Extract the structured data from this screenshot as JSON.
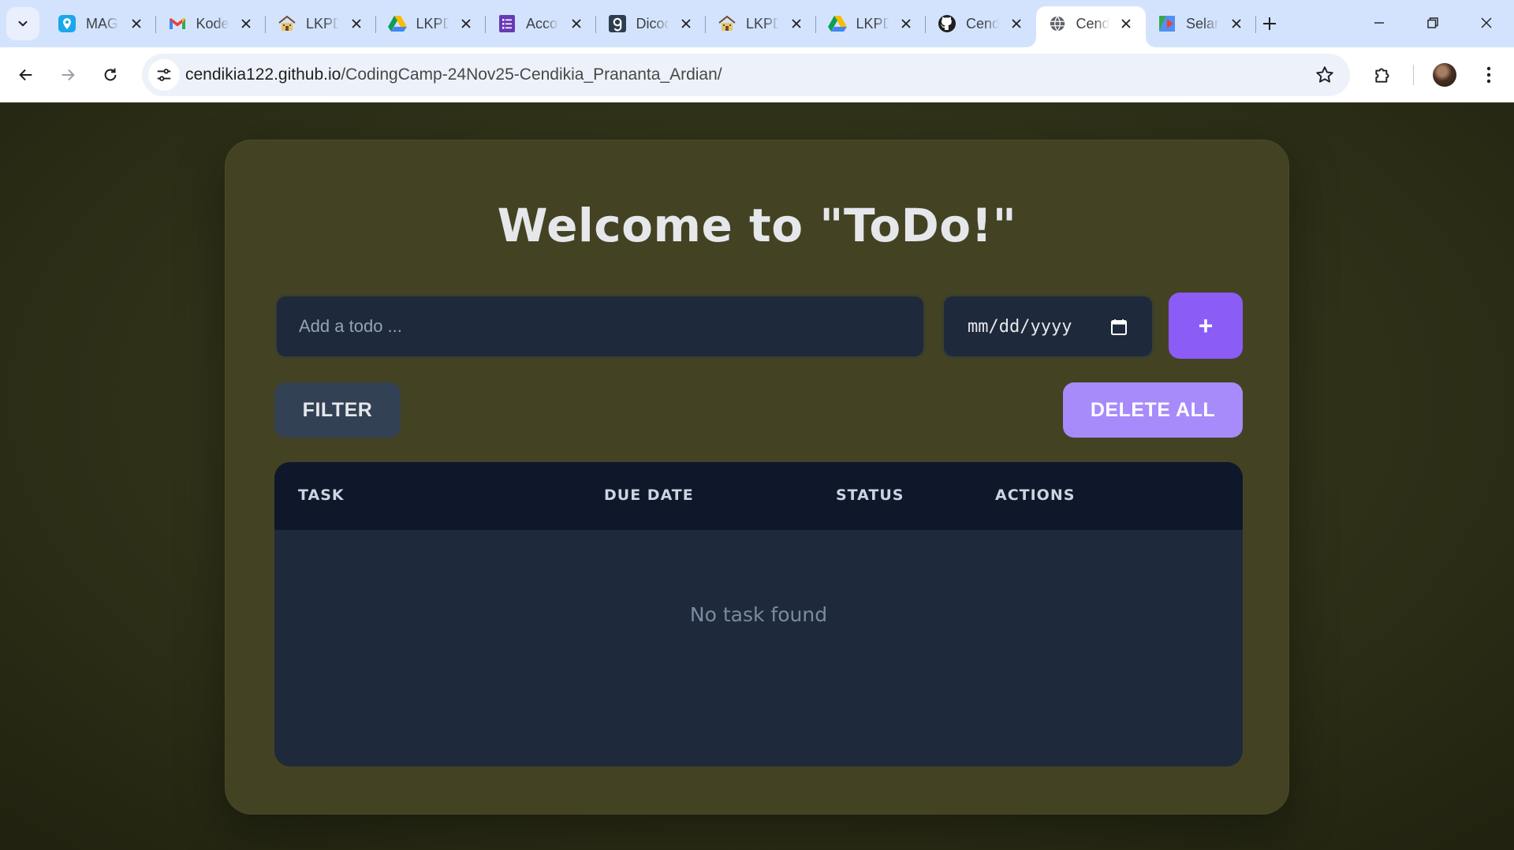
{
  "browser": {
    "tabs": [
      {
        "title": "MAGANG",
        "icon": "maps-pin-icon",
        "active": false
      },
      {
        "title": "Kode Verifikasi",
        "icon": "gmail-icon",
        "active": false
      },
      {
        "title": "LKPD",
        "icon": "school-icon",
        "active": false
      },
      {
        "title": "LKPD",
        "icon": "google-drive-icon",
        "active": false
      },
      {
        "title": "Accounting",
        "icon": "forms-icon",
        "active": false
      },
      {
        "title": "Dicoding",
        "icon": "dicoding-icon",
        "active": false
      },
      {
        "title": "LKPD",
        "icon": "school-icon",
        "active": false
      },
      {
        "title": "LKPD",
        "icon": "google-drive-icon",
        "active": false
      },
      {
        "title": "Cendikia",
        "icon": "github-icon",
        "active": false
      },
      {
        "title": "Cendikia",
        "icon": "globe-icon",
        "active": true
      },
      {
        "title": "Selamat",
        "icon": "kanban-icon",
        "active": false
      }
    ],
    "url_host": "cendikia122.github.io",
    "url_path": "/CodingCamp-24Nov25-Cendikia_Prananta_Ardian/"
  },
  "app": {
    "title": "Welcome to \"ToDo!\"",
    "todo_placeholder": "Add a todo ...",
    "date_placeholder": "mm/dd/yyyy",
    "add_label": "+",
    "filter_label": "FILTER",
    "delete_all_label": "DELETE ALL",
    "table": {
      "columns": [
        "TASK",
        "DUE DATE",
        "STATUS",
        "ACTIONS"
      ],
      "empty_message": "No task found"
    }
  },
  "colors": {
    "background": "#2c2e17",
    "card": "#434323",
    "input_bg": "#1e293b",
    "accent": "#8b5cf6",
    "accent_light": "#a78bfa",
    "filter_bg": "#334155",
    "table_header": "#0f172a"
  }
}
